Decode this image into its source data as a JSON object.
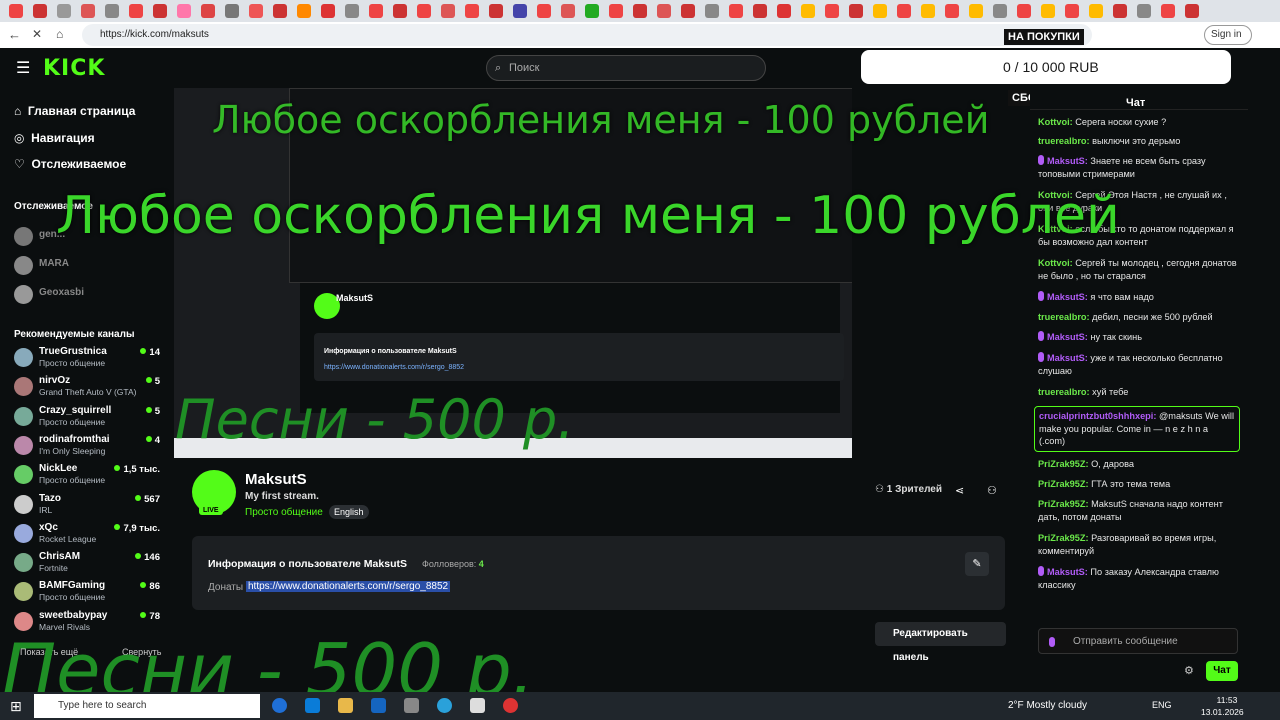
{
  "browser": {
    "url": "https://kick.com/maksuts",
    "signin": "Sign in"
  },
  "header": {
    "logo": "KICK",
    "search_placeholder": "Поиск",
    "goal_text": "0 / 10 000 RUB",
    "goal_caption_top": "НА ПОКУПКИ",
    "goal_caption_bottom": "СБОР ЗАВЕРШЁН"
  },
  "sidebar": {
    "nav": [
      "Главная страница",
      "Навигация",
      "Отслеживаемое"
    ],
    "following_title": "Отслеживаемое",
    "following": [
      {
        "name": "gen..."
      },
      {
        "name": "MARA"
      },
      {
        "name": "Geoxasbi"
      }
    ],
    "recommended_title": "Рекомендуемые каналы",
    "channels": [
      {
        "name": "TrueGrustnica",
        "sub": "Просто общение",
        "viewers": "14"
      },
      {
        "name": "nirvOz",
        "sub": "Grand Theft Auto V (GTA)",
        "viewers": "5"
      },
      {
        "name": "Crazy_squirrell",
        "sub": "Просто общение",
        "viewers": "5"
      },
      {
        "name": "rodinafromthai",
        "sub": "I'm Only Sleeping",
        "viewers": "4"
      },
      {
        "name": "NickLee",
        "sub": "Просто общение",
        "viewers": "1,5 тыс."
      },
      {
        "name": "Tazo",
        "sub": "IRL",
        "viewers": "567"
      },
      {
        "name": "xQc",
        "sub": "Rocket League",
        "viewers": "7,9 тыс."
      },
      {
        "name": "ChrisAM",
        "sub": "Fortnite",
        "viewers": "146"
      },
      {
        "name": "BAMFGaming",
        "sub": "Просто общение",
        "viewers": "86"
      },
      {
        "name": "sweetbabypay",
        "sub": "Marvel Rivals",
        "viewers": "78"
      }
    ],
    "show_more": "Показать ещё",
    "collapse": "Свернуть"
  },
  "stream": {
    "name": "MaksutS",
    "title": "My first stream.",
    "category": "Просто общение",
    "language": "English",
    "live": "LIVE",
    "viewers": "1 Зрителей",
    "info_title": "Информация о пользователе MaksutS",
    "followers_label": "Фолловеров:",
    "followers": "4",
    "donate_label": "Донаты",
    "donate_link": "https://www.donationalerts.com/r/sergo_8852",
    "edit_panel": "Редактировать панель"
  },
  "chat": {
    "title": "Чат",
    "input_placeholder": "Отправить сообщение",
    "send_label": "Чат",
    "messages": [
      {
        "user": "Kottvoi",
        "text": "Серега носки сухие ?",
        "badge": false,
        "highlight": false
      },
      {
        "user": "truerealbro",
        "text": "выключи это дерьмо",
        "badge": false,
        "highlight": false
      },
      {
        "user": "MaksutS",
        "text": "Знаете не всем быть сразу топовыми стримерами",
        "badge": true,
        "highlight": false
      },
      {
        "user": "Kottvoi",
        "text": "Сергей Этоя Настя , не слушай их , они все дураки",
        "badge": false,
        "highlight": false
      },
      {
        "user": "Kottvoi",
        "text": "если бы кто то донатом поддержал я бы возможно дал контент",
        "badge": false,
        "highlight": false
      },
      {
        "user": "Kottvoi",
        "text": "Сергей ты молодец , сегодня донатов не было , но ты старался",
        "badge": false,
        "highlight": false
      },
      {
        "user": "MaksutS",
        "text": "я что вам надо",
        "badge": true,
        "highlight": false
      },
      {
        "user": "truerealbro",
        "text": "дебил, песни же 500 рублей",
        "badge": false,
        "highlight": false
      },
      {
        "user": "MaksutS",
        "text": "ну так скинь",
        "badge": true,
        "highlight": false
      },
      {
        "user": "MaksutS",
        "text": "уже и так несколько бесплатно слушаю",
        "badge": true,
        "highlight": false
      },
      {
        "user": "truerealbro",
        "text": "хуй тебе",
        "badge": false,
        "highlight": false
      },
      {
        "user": "crucialprintzbut0shhhxepi",
        "text": "@maksuts We will make you popular. Come in — n e z h n a (.com)",
        "badge": false,
        "highlight": true
      },
      {
        "user": "PriZrak95Z",
        "text": "О, дарова",
        "badge": false,
        "highlight": false
      },
      {
        "user": "PriZrak95Z",
        "text": "ГТА это тема тема",
        "badge": false,
        "highlight": false
      },
      {
        "user": "PriZrak95Z",
        "text": "MaksutS сначала надо контент дать, потом донаты",
        "badge": false,
        "highlight": false
      },
      {
        "user": "PriZrak95Z",
        "text": "Разговаривай во время игры, комментируй",
        "badge": false,
        "highlight": false
      },
      {
        "user": "MaksutS",
        "text": "По заказу Александра ставлю классику",
        "badge": true,
        "highlight": false
      }
    ]
  },
  "overlays": {
    "insult_text": "Любое оскорбления меня - 100 рублей",
    "song_text": "Песни - 500 р."
  },
  "taskbar": {
    "search_placeholder": "Type here to search",
    "weather": "2°F  Mostly cloudy",
    "lang": "ENG",
    "time": "11:53",
    "date": "13.01.2026"
  },
  "colors": {
    "accent": "#53fc18",
    "bg": "#0b0e0f",
    "purple_user": "#b15cf7"
  }
}
